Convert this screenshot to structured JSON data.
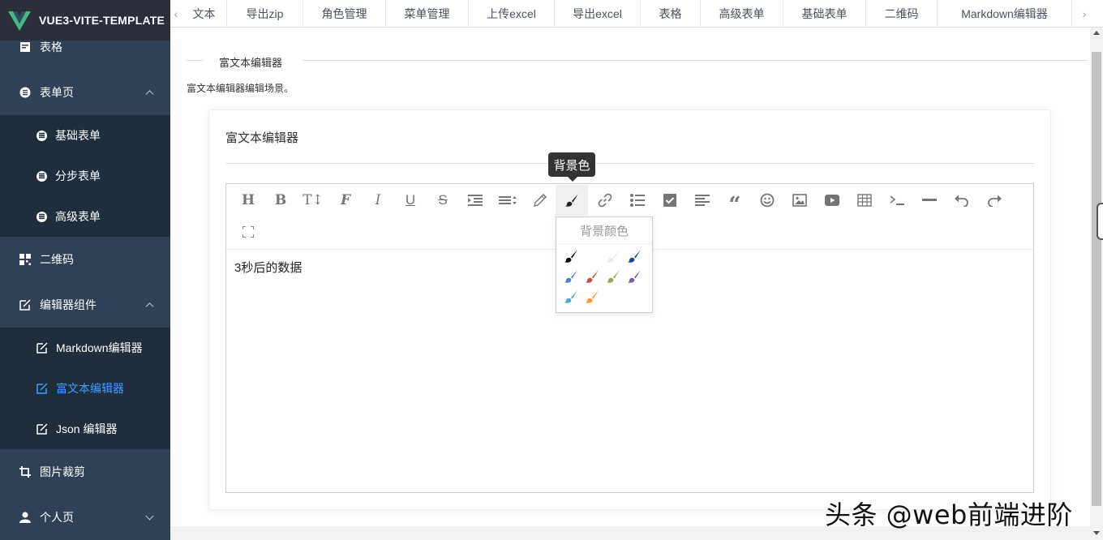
{
  "app": {
    "title": "VUE3-VITE-TEMPLATE"
  },
  "sidebar": {
    "items": [
      {
        "label": "表格",
        "icon": "table-icon"
      },
      {
        "label": "表单页",
        "icon": "form-icon",
        "expanded": true,
        "children": [
          {
            "label": "基础表单"
          },
          {
            "label": "分步表单"
          },
          {
            "label": "高级表单"
          }
        ]
      },
      {
        "label": "二维码",
        "icon": "qrcode-icon"
      },
      {
        "label": "编辑器组件",
        "icon": "edit-icon",
        "expanded": true,
        "children": [
          {
            "label": "Markdown编辑器"
          },
          {
            "label": "富文本编辑器",
            "active": true
          },
          {
            "label": "Json 编辑器"
          }
        ]
      },
      {
        "label": "图片裁剪",
        "icon": "crop-icon"
      },
      {
        "label": "个人页",
        "icon": "user-icon",
        "expanded": false
      }
    ]
  },
  "tabs": [
    "文本",
    "导出zip",
    "角色管理",
    "菜单管理",
    "上传excel",
    "导出excel",
    "表格",
    "高级表单",
    "基础表单",
    "二维码",
    "Markdown编辑器"
  ],
  "page": {
    "divider_title": "富文本编辑器",
    "description": "富文本编辑器编辑场景。",
    "card_title": "富文本编辑器"
  },
  "editor": {
    "content": "3秒后的数据",
    "tooltip": "背景色",
    "dropdown_title": "背景颜色",
    "swatch_colors": [
      "#000000",
      "#eeece0",
      "#1c487f",
      "#4d80bf",
      "#c24f4a",
      "#8baa4a",
      "#7b5ba1",
      "#46acc8",
      "#f9963b"
    ],
    "toolbar_icons": [
      "heading-icon",
      "bold-icon",
      "font-size-icon",
      "font-family-icon",
      "italic-icon",
      "underline-icon",
      "strikethrough-icon",
      "indent-icon",
      "line-height-icon",
      "font-color-icon",
      "background-color-icon",
      "link-icon",
      "list-icon",
      "todo-icon",
      "justify-icon",
      "quote-icon",
      "emoticon-icon",
      "image-icon",
      "video-icon",
      "table-icon",
      "code-icon",
      "split-line-icon",
      "undo-icon",
      "redo-icon",
      "fullscreen-icon"
    ]
  },
  "watermark": "头条 @web前端进阶"
}
